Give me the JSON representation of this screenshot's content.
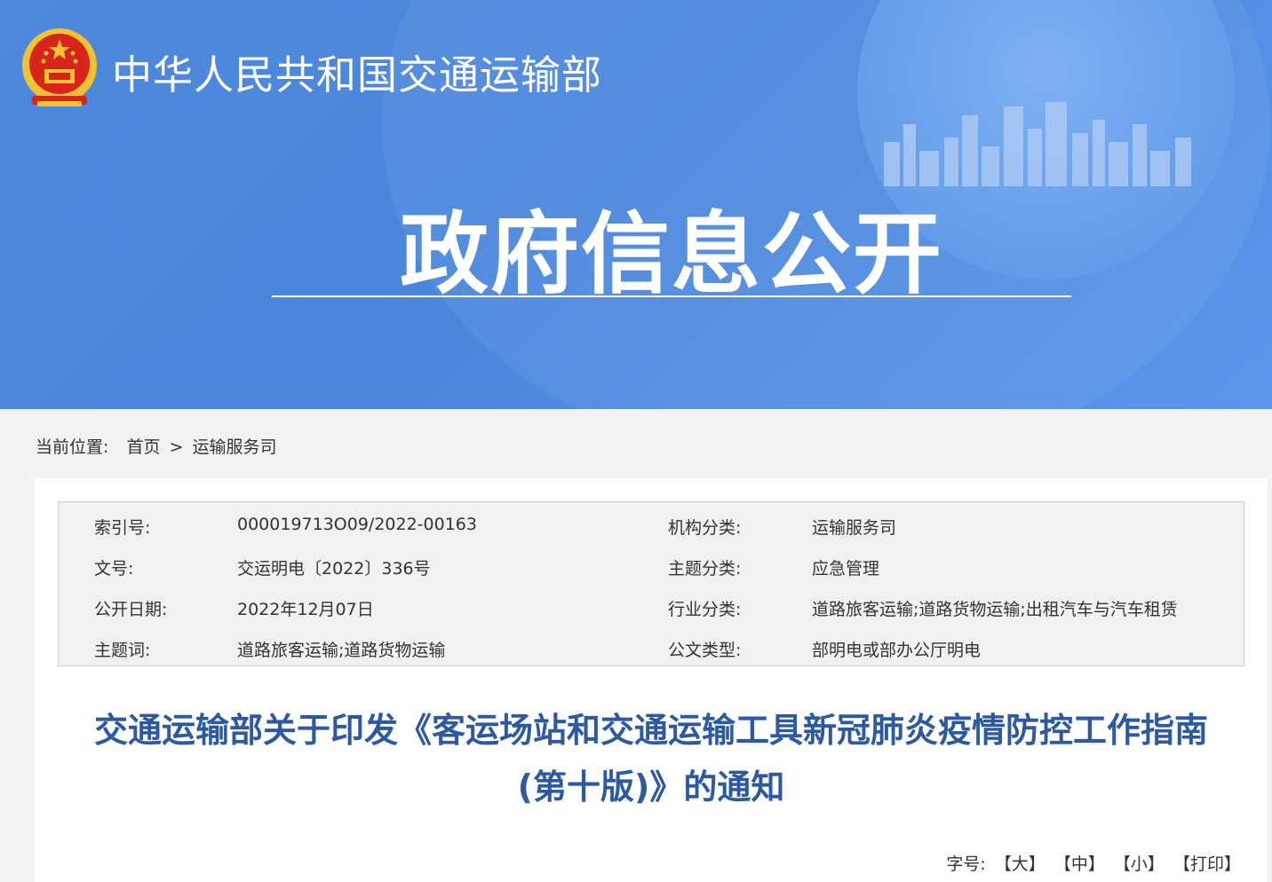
{
  "header": {
    "ministry_name": "中华人民共和国交通运输部",
    "section_title": "政府信息公开"
  },
  "breadcrumb": {
    "label": "当前位置:",
    "home": "首页",
    "separator": ">",
    "current": "运输服务司"
  },
  "meta": {
    "rows": [
      {
        "label1": "索引号:",
        "value1": "000019713O09/2022-00163",
        "label2": "机构分类:",
        "value2": "运输服务司"
      },
      {
        "label1": "文号:",
        "value1": "交运明电〔2022〕336号",
        "label2": "主题分类:",
        "value2": "应急管理"
      },
      {
        "label1": "公开日期:",
        "value1": "2022年12月07日",
        "label2": "行业分类:",
        "value2": "道路旅客运输;道路货物运输;出租汽车与汽车租赁"
      },
      {
        "label1": "主题词:",
        "value1": "道路旅客运输;道路货物运输",
        "label2": "公文类型:",
        "value2": "部明电或部办公厅明电"
      }
    ]
  },
  "document": {
    "title_line1": "交通运输部关于印发《客运场站和交通运输工具新冠肺炎疫情防控工作指南",
    "title_line2": "(第十版)》的通知"
  },
  "font_controls": {
    "label": "字号:",
    "large": "【大】",
    "medium": "【中】",
    "small": "【小】",
    "print": "【打印】"
  },
  "colors": {
    "banner_blue": "#4e89dd",
    "title_blue": "#2b5aa1",
    "emblem_red": "#d8251a",
    "emblem_gold": "#f1c232"
  }
}
